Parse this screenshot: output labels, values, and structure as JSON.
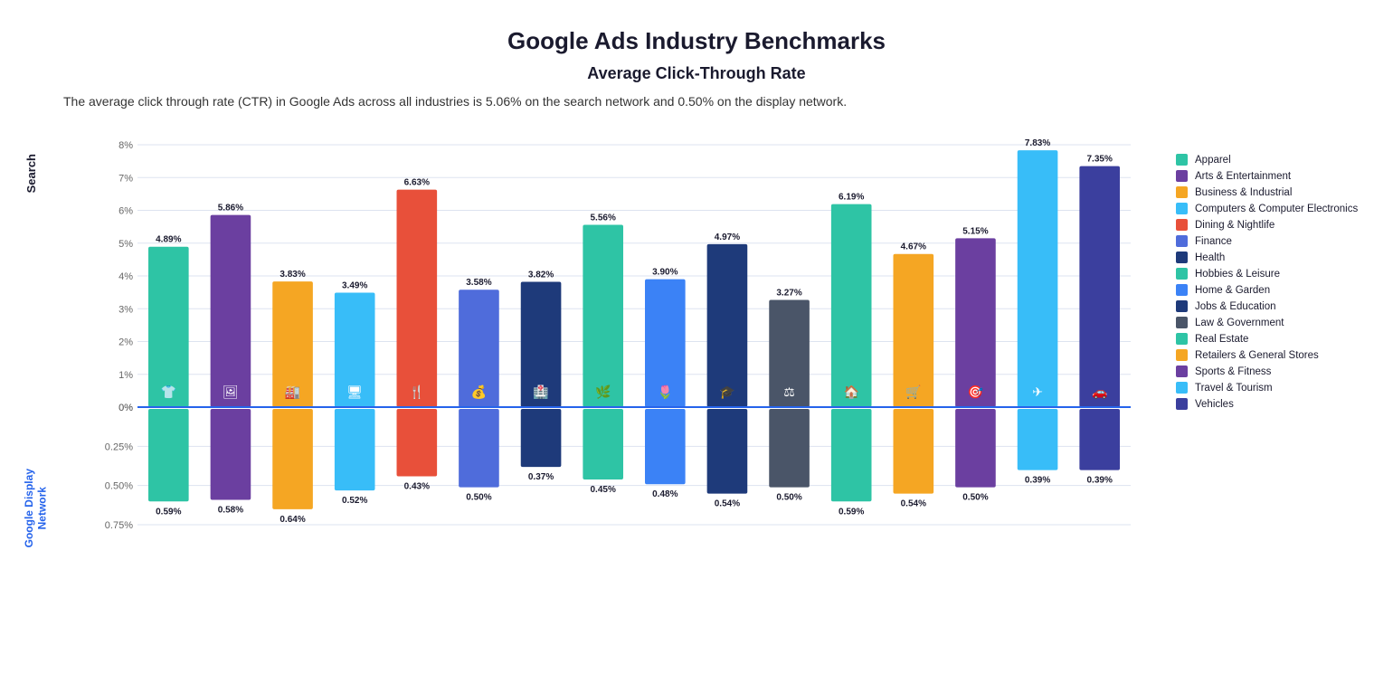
{
  "title": "Google Ads Industry Benchmarks",
  "subtitle": "Average Click-Through Rate",
  "description": "The average click through rate (CTR) in Google Ads across all industries is 5.06% on the search network and 0.50% on the display network.",
  "yAxis": {
    "searchLabels": [
      "8%",
      "7%",
      "6%",
      "5%",
      "4%",
      "3%",
      "2%",
      "1%",
      "0%"
    ],
    "displayLabels": [
      "0%",
      "0.25%",
      "0.50%",
      "0.75%"
    ]
  },
  "industries": [
    {
      "name": "Apparel",
      "color": "#2ec4a5",
      "searchVal": 4.89,
      "displayVal": 0.59,
      "icon": "👕"
    },
    {
      "name": "Arts & Entertainment",
      "color": "#6b3fa0",
      "searchVal": 5.86,
      "displayVal": 0.58,
      "icon": "🖼"
    },
    {
      "name": "Business & Industrial",
      "color": "#f5a623",
      "searchVal": 3.83,
      "displayVal": 0.64,
      "icon": "🏭"
    },
    {
      "name": "Computers & Computer Electronics",
      "color": "#38bdf8",
      "searchVal": 3.49,
      "displayVal": 0.52,
      "icon": "🖥"
    },
    {
      "name": "Dining & Nightlife",
      "color": "#e8503a",
      "searchVal": 6.63,
      "displayVal": 0.43,
      "icon": "🍴"
    },
    {
      "name": "Finance",
      "color": "#4f6cdb",
      "searchVal": 3.58,
      "displayVal": 0.5,
      "icon": "💰"
    },
    {
      "name": "Health",
      "color": "#1e3a7a",
      "searchVal": 3.82,
      "displayVal": 0.37,
      "icon": "🏥"
    },
    {
      "name": "Hobbies & Leisure",
      "color": "#2ec4a5",
      "searchVal": 5.56,
      "displayVal": 0.45,
      "icon": "🌿"
    },
    {
      "name": "Home & Garden",
      "color": "#3b82f6",
      "searchVal": 3.9,
      "displayVal": 0.48,
      "icon": "🌷"
    },
    {
      "name": "Jobs & Education",
      "color": "#1e3a7a",
      "searchVal": 4.97,
      "displayVal": 0.54,
      "icon": "🎓"
    },
    {
      "name": "Law & Government",
      "color": "#4a5568",
      "searchVal": 3.27,
      "displayVal": 0.5,
      "icon": "⚖"
    },
    {
      "name": "Real Estate",
      "color": "#2ec4a5",
      "searchVal": 6.19,
      "displayVal": 0.59,
      "icon": "🏠"
    },
    {
      "name": "Retailers & General Stores",
      "color": "#f5a623",
      "searchVal": 4.67,
      "displayVal": 0.54,
      "icon": "🛒"
    },
    {
      "name": "Sports & Fitness",
      "color": "#6b3fa0",
      "searchVal": 5.15,
      "displayVal": 0.5,
      "icon": "🎯"
    },
    {
      "name": "Travel & Tourism",
      "color": "#38bdf8",
      "searchVal": 7.83,
      "displayVal": 0.39,
      "icon": "✈"
    },
    {
      "name": "Vehicles",
      "color": "#3b3f9e",
      "searchVal": 7.35,
      "displayVal": 0.39,
      "icon": "🚗"
    }
  ],
  "legend": [
    {
      "name": "Apparel",
      "color": "#2ec4a5"
    },
    {
      "name": "Arts & Entertainment",
      "color": "#6b3fa0"
    },
    {
      "name": "Business & Industrial",
      "color": "#f5a623"
    },
    {
      "name": "Computers & Computer Electronics",
      "color": "#38bdf8"
    },
    {
      "name": "Dining & Nightlife",
      "color": "#e8503a"
    },
    {
      "name": "Finance",
      "color": "#4f6cdb"
    },
    {
      "name": "Health",
      "color": "#1e3a7a"
    },
    {
      "name": "Hobbies & Leisure",
      "color": "#2ec4a5"
    },
    {
      "name": "Home & Garden",
      "color": "#3b82f6"
    },
    {
      "name": "Jobs & Education",
      "color": "#1e3a7a"
    },
    {
      "name": "Law & Government",
      "color": "#4a5568"
    },
    {
      "name": "Real Estate",
      "color": "#2ec4a5"
    },
    {
      "name": "Retailers & General Stores",
      "color": "#f5a623"
    },
    {
      "name": "Sports & Fitness",
      "color": "#6b3fa0"
    },
    {
      "name": "Travel & Tourism",
      "color": "#38bdf8"
    },
    {
      "name": "Vehicles",
      "color": "#3b3f9e"
    }
  ]
}
